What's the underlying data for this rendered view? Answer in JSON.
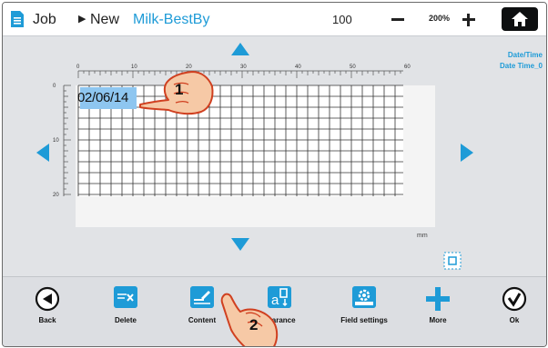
{
  "topbar": {
    "job_label": "Job",
    "new_label": "New",
    "job_name": "Milk-BestBy",
    "chars_count": "100",
    "zoom_level": "200%",
    "icons": [
      "document-icon",
      "zoom-out-icon",
      "zoom-in-icon",
      "home-icon"
    ]
  },
  "field_tag": {
    "type": "Date/Time",
    "name": "Date Time_0"
  },
  "canvas": {
    "ruler_x_labels": [
      "0",
      "10",
      "20",
      "30",
      "40",
      "50",
      "60"
    ],
    "ruler_y_labels": [
      "0",
      "10",
      "20"
    ],
    "unit": "mm",
    "date_field_text": "02/06/14"
  },
  "toolbar": {
    "buttons": [
      {
        "id": "back",
        "label": "Back",
        "icon": "back-arrow-icon"
      },
      {
        "id": "delete",
        "label": "Delete",
        "icon": "delete-field-icon"
      },
      {
        "id": "content",
        "label": "Content",
        "icon": "edit-content-icon"
      },
      {
        "id": "appearance",
        "label": "pearance",
        "icon": "appearance-icon"
      },
      {
        "id": "field-settings",
        "label": "Field settings",
        "icon": "field-settings-icon"
      },
      {
        "id": "more",
        "label": "More",
        "icon": "plus-icon"
      },
      {
        "id": "ok",
        "label": "Ok",
        "icon": "checkmark-icon"
      }
    ]
  },
  "callouts": [
    "1",
    "2"
  ],
  "colors": {
    "accent": "#1e9bd7",
    "selection": "#8ec6f0",
    "background": "#e1e3e6",
    "hand_fill": "#f6c9a6",
    "hand_stroke": "#d04020"
  }
}
